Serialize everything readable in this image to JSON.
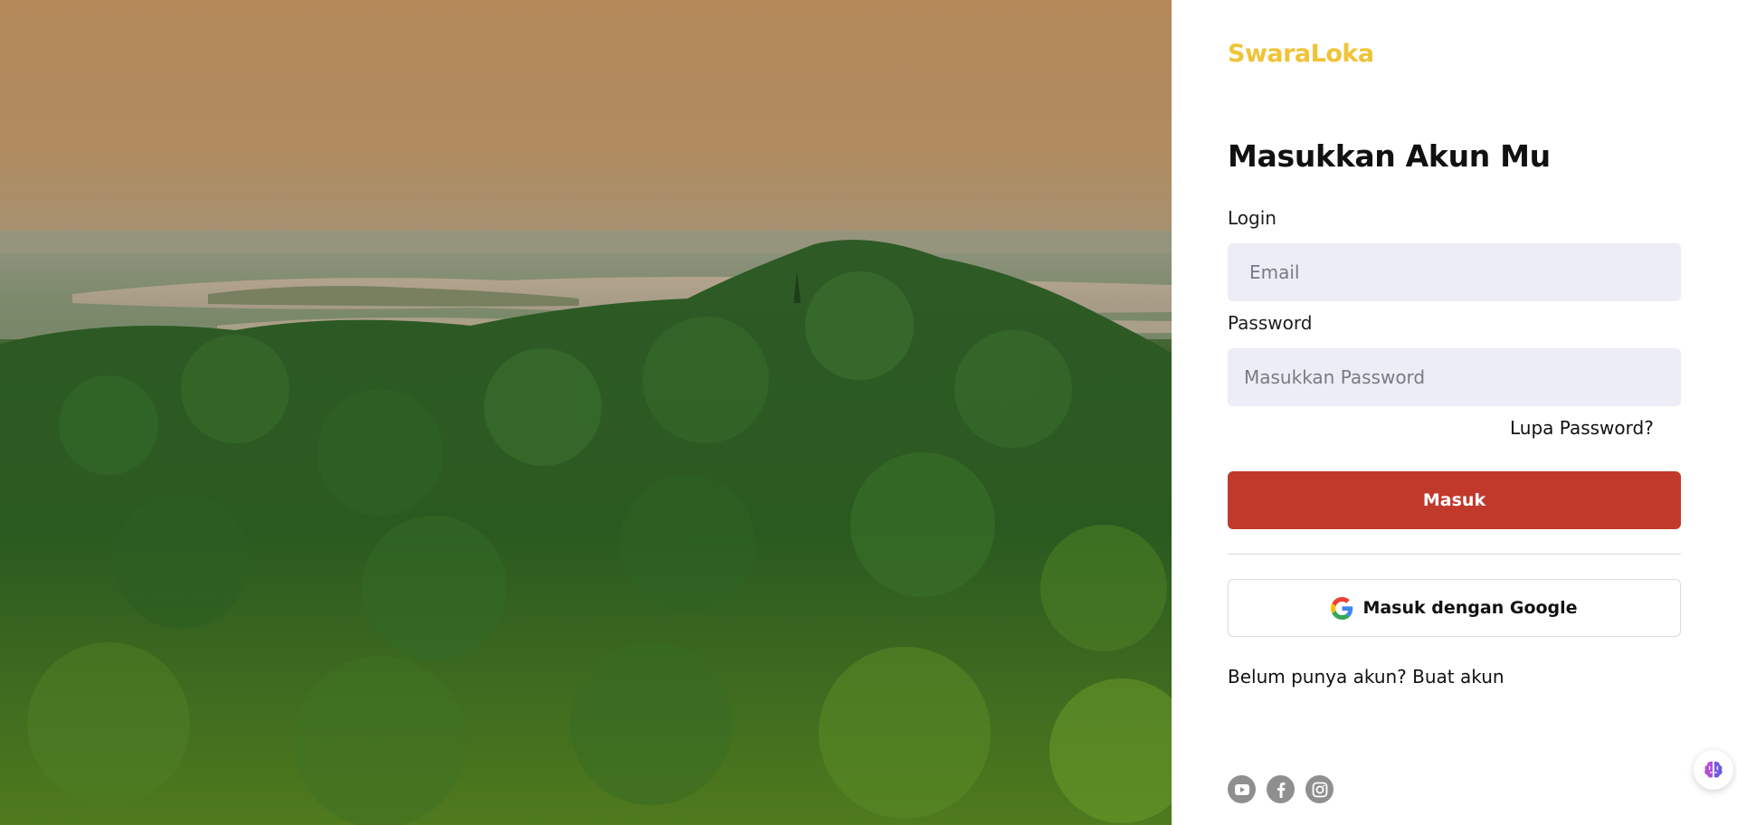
{
  "brand": {
    "name": "SwaraLoka",
    "color": "#f0c337"
  },
  "form": {
    "heading": "Masukkan Akun Mu",
    "login_label": "Login",
    "email_placeholder": "Email",
    "email_value": "",
    "password_label": "Password",
    "password_placeholder": "Masukkan Password",
    "password_value": "",
    "forgot_link": "Lupa Password?",
    "submit_label": "Masuk",
    "submit_color": "#c0392b",
    "google_label": "Masuk dengan Google",
    "signup_prompt": "Belum punya akun?",
    "signup_link": "Buat akun"
  },
  "socials": [
    {
      "icon": "youtube-icon"
    },
    {
      "icon": "facebook-icon"
    },
    {
      "icon": "instagram-icon"
    }
  ],
  "floating_action": {
    "icon": "brain-icon"
  },
  "hero": {
    "image": "forest-landscape-at-sunset"
  }
}
